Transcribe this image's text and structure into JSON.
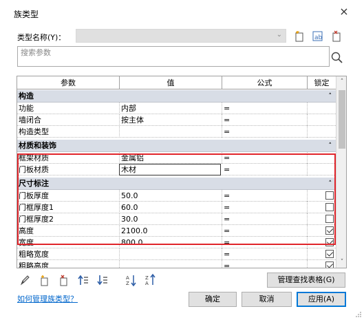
{
  "window": {
    "title": "族类型",
    "close_glyph": "×"
  },
  "type_row": {
    "label": "类型名称(Y)：",
    "value": ""
  },
  "search": {
    "placeholder": "搜索参数"
  },
  "table": {
    "headers": [
      "参数",
      "值",
      "公式",
      "锁定"
    ],
    "groups": [
      {
        "name": "构造",
        "toggle": "⌃",
        "rows": [
          {
            "param": "功能",
            "value": "内部",
            "formula": "=",
            "lock": null
          },
          {
            "param": "墙闭合",
            "value": "按主体",
            "formula": "=",
            "lock": null
          },
          {
            "param": "构造类型",
            "value": "",
            "formula": "=",
            "lock": null
          }
        ]
      },
      {
        "name": "材质和装饰",
        "toggle": "⌃",
        "rows": [
          {
            "param": "框架材质",
            "value": "金属铝",
            "formula": "=",
            "lock": null
          },
          {
            "param": "门板材质",
            "value": "木材",
            "formula": "=",
            "lock": null
          }
        ]
      },
      {
        "name": "尺寸标注",
        "toggle": "⌃",
        "rows": [
          {
            "param": "门板厚度",
            "value": "50.0",
            "formula": "=",
            "lock": false
          },
          {
            "param": "门框厚度1",
            "value": "60.0",
            "formula": "=",
            "lock": false
          },
          {
            "param": "门框厚度2",
            "value": "30.0",
            "formula": "=",
            "lock": false
          },
          {
            "param": "高度",
            "value": "2100.0",
            "formula": "=",
            "lock": true
          },
          {
            "param": "宽度",
            "value": "800.0",
            "formula": "=",
            "lock": true
          },
          {
            "param": "粗略宽度",
            "value": "",
            "formula": "=",
            "lock": true
          },
          {
            "param": "粗略高度",
            "value": "",
            "formula": "=",
            "lock": true
          }
        ]
      }
    ]
  },
  "bottom": {
    "manage_lookup": "管理查找表格(G)",
    "help_link": "如何管理族类型？",
    "ok": "确定",
    "cancel": "取消",
    "apply": "应用(A)"
  },
  "colors": {
    "highlight": "#e0242a",
    "group_bg": "#d8dde6",
    "link": "#0066cc",
    "primary_border": "#0078d7"
  },
  "icons": [
    "new-type-icon",
    "rename-type-icon",
    "delete-type-icon",
    "pencil-icon",
    "new-param-icon",
    "delete-param-icon",
    "move-up-icon",
    "move-down-icon",
    "sort-ascending-icon",
    "sort-descending-icon",
    "search-icon",
    "close-icon"
  ]
}
